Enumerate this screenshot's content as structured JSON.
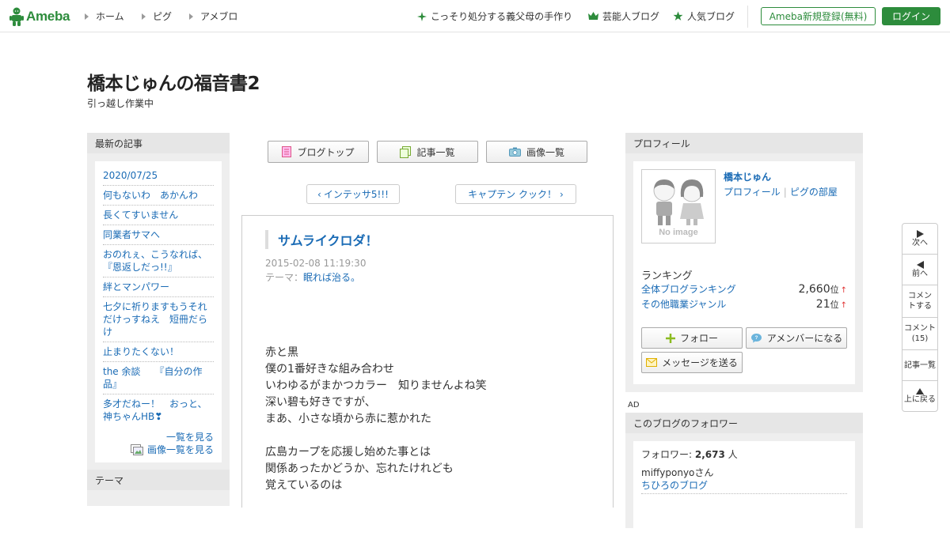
{
  "header": {
    "logo_text": "Ameba",
    "nav_left": [
      "ホーム",
      "ピグ",
      "アメブロ"
    ],
    "nav_right": [
      {
        "icon": "sparkle-icon",
        "label": "こっそり処分する義父母の手作り"
      },
      {
        "icon": "crown-icon",
        "label": "芸能人ブログ"
      },
      {
        "icon": "star-icon",
        "label": "人気ブログ"
      }
    ],
    "register_label": "Ameba新規登録(無料)",
    "login_label": "ログイン",
    "accent_color": "#2d8c3c"
  },
  "blog": {
    "title": "橋本じゅんの福音書2",
    "description": "引っ越し作業中"
  },
  "sidebar_left": {
    "latest_heading": "最新の記事",
    "items": [
      "2020/07/25",
      "何もないわ　あかんわ",
      "長くてすいません",
      "同業者サマへ",
      "おのれぇ、こうなれば、『恩返しだっ!!』",
      "絆とマンパワー",
      "七夕に祈りますもうそれだけっすねえ　短冊だらけ",
      "止まりたくない！",
      "the 余談　　『自分の作品』",
      "多才だねー！　おっと、神ちゃんHB❣"
    ],
    "see_all": "一覧を見る",
    "see_images": "画像一覧を見る",
    "theme_heading": "テーマ"
  },
  "toolbar": {
    "blog_top": "ブログトップ",
    "entry_list": "記事一覧",
    "image_list": "画像一覧"
  },
  "pager": {
    "prev": "インテッサ5!!!",
    "next": "キャプテン クック！"
  },
  "article": {
    "title": "サムライクロダ！",
    "date": "2015-02-08 11:19:30",
    "theme_prefix": "テーマ：",
    "theme": "眠れば治る。",
    "body": [
      "赤と黒",
      "僕の1番好きな組み合わせ",
      "いわゆるがまかつカラー　知りませんよね笑",
      "深い碧も好きですが、",
      "まあ、小さな頃から赤に惹かれた",
      "",
      "広島カープを応援し始めた事とは",
      "関係あったかどうか、忘れたけれども",
      "覚えているのは"
    ]
  },
  "profile": {
    "heading": "プロフィール",
    "avatar_text": "No image",
    "name": "橋本じゅん",
    "link_profile": "プロフィール",
    "link_pig": "ピグの部屋",
    "ranking_heading": "ランキング",
    "rankings": [
      {
        "label": "全体ブログランキング",
        "value": "2,660",
        "unit": "位",
        "trend": "↑"
      },
      {
        "label": "その他職業ジャンル",
        "value": "21",
        "unit": "位",
        "trend": "↑"
      }
    ],
    "follow": "フォロー",
    "amember": "アメンバーになる",
    "message": "メッセージを送る"
  },
  "ad_label": "AD",
  "followers": {
    "heading": "このブログのフォロワー",
    "count_prefix": "フォロワー: ",
    "count": "2,673",
    "count_suffix": " 人",
    "first_user": "miffyponyoさん",
    "first_blog": "ちひろのブログ"
  },
  "sidenav": {
    "next": "次へ",
    "prev": "前へ",
    "comment": "コメントする",
    "comments": "コメント(15)",
    "entry_list": "記事一覧",
    "top": "上に戻る"
  }
}
